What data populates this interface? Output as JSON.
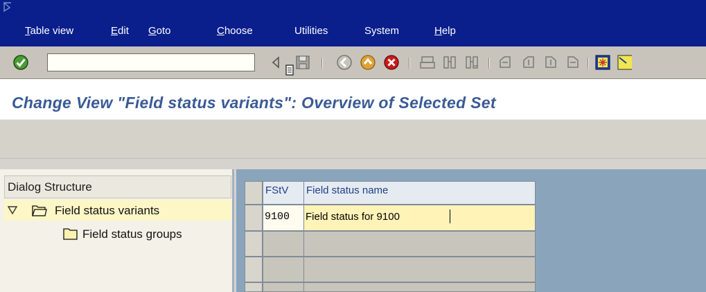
{
  "menu": {
    "items": [
      {
        "ul": "T",
        "rest": "able view"
      },
      {
        "ul": "E",
        "rest": "dit"
      },
      {
        "ul": "G",
        "rest": "oto"
      },
      {
        "ul": "C",
        "rest": "hoose"
      },
      {
        "ul": "",
        "rest": "Utilities"
      },
      {
        "ul": "",
        "rest": "System"
      },
      {
        "ul": "H",
        "rest": "elp"
      }
    ]
  },
  "toolbar": {
    "command_field_value": "",
    "icons": [
      "enter-icon",
      "back-icon",
      "save-icon",
      "back-green-icon",
      "exit-icon",
      "cancel-icon",
      "print-icon",
      "find-icon",
      "find-next-icon",
      "first-page-icon",
      "previous-page-icon",
      "next-page-icon",
      "last-page-icon",
      "create-session-icon"
    ]
  },
  "page": {
    "title": "Change View \"Field status variants\": Overview of Selected Set"
  },
  "dialog_structure": {
    "header": "Dialog Structure",
    "items": [
      {
        "label": "Field status variants",
        "selected": true,
        "expanded": true
      },
      {
        "label": "Field status groups",
        "selected": false
      }
    ]
  },
  "table": {
    "columns": [
      "FStV",
      "Field status name"
    ],
    "rows": [
      [
        "9100",
        "Field status for 9100"
      ],
      [
        "",
        ""
      ],
      [
        "",
        ""
      ],
      [
        "",
        ""
      ]
    ]
  },
  "colors": {
    "menubar": "#0a1e8c",
    "title": "#3a5a96",
    "panel_selected": "#fdf6c6",
    "right_area": "#8aa5bb"
  }
}
